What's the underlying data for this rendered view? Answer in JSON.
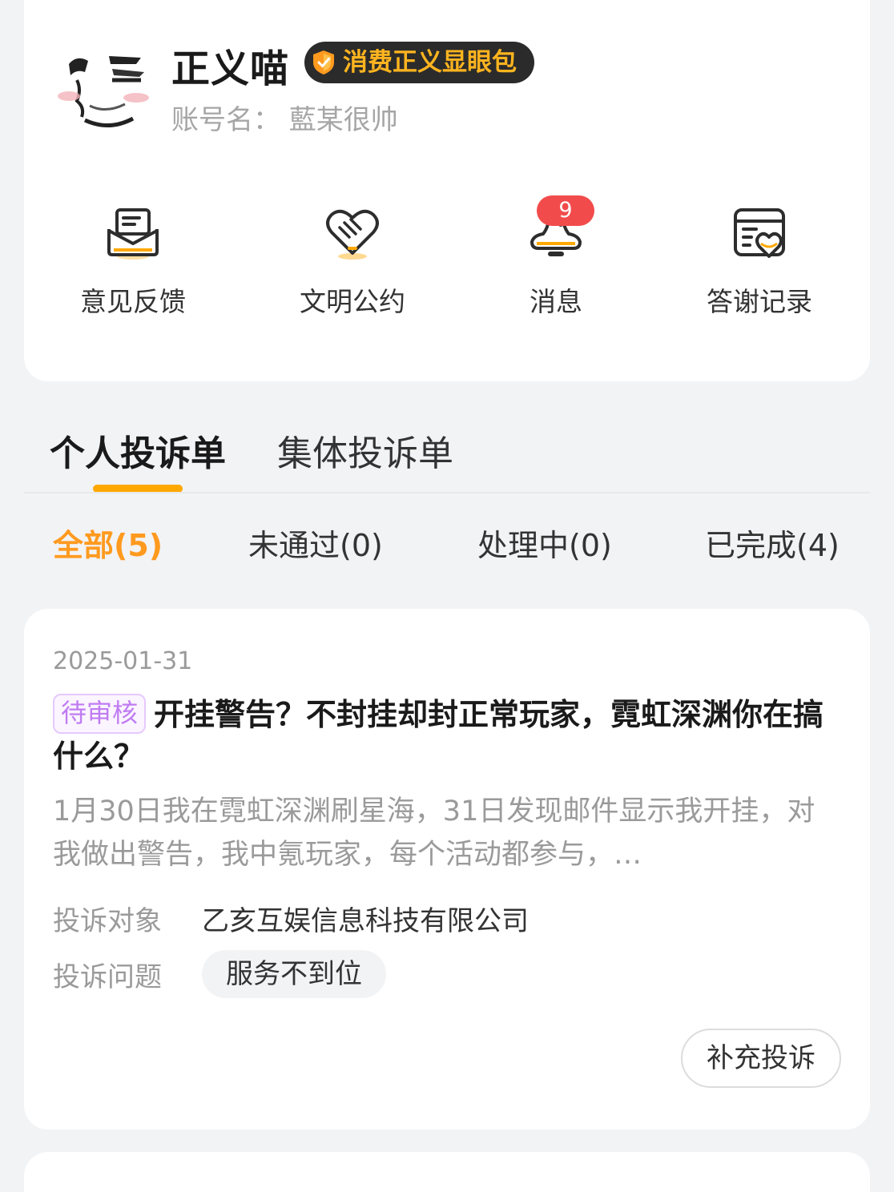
{
  "profile": {
    "nickname": "正义喵",
    "badge": "消费正义显眼包",
    "account": "账号名： 藍某很帅",
    "colors": {
      "badge_bg": "#2b2b2b",
      "badge_text": "#ffb41f",
      "accent": "#ffa800"
    }
  },
  "shortcuts": [
    {
      "label": "意见反馈",
      "icon": "feedback-envelope-icon"
    },
    {
      "label": "文明公约",
      "icon": "heart-handshake-icon"
    },
    {
      "label": "消息",
      "icon": "megaphone-icon",
      "count": "9"
    },
    {
      "label": "答谢记录",
      "icon": "thanks-card-heart-icon"
    }
  ],
  "tabs": [
    {
      "label": "个人投诉单",
      "active": true
    },
    {
      "label": "集体投诉单",
      "active": false
    }
  ],
  "filters": [
    {
      "label": "全部(5)",
      "active": true
    },
    {
      "label": "未通过(0)",
      "active": false
    },
    {
      "label": "处理中(0)",
      "active": false
    },
    {
      "label": "已完成(4)",
      "active": false
    }
  ],
  "complaint": {
    "date": "2025-01-31",
    "status": "待审核",
    "title": "开挂警告？不封挂却封正常玩家，霓虹深渊你在搞什么？",
    "description": "1月30日我在霓虹深渊刷星海，31日发现邮件显示我开挂，对我做出警告，我中氪玩家，每个活动都参与，…",
    "target_label": "投诉对象",
    "target_value": "乙亥互娱信息科技有限公司",
    "issue_label": "投诉问题",
    "issue_value": "服务不到位",
    "supplement_button": "补充投诉"
  }
}
